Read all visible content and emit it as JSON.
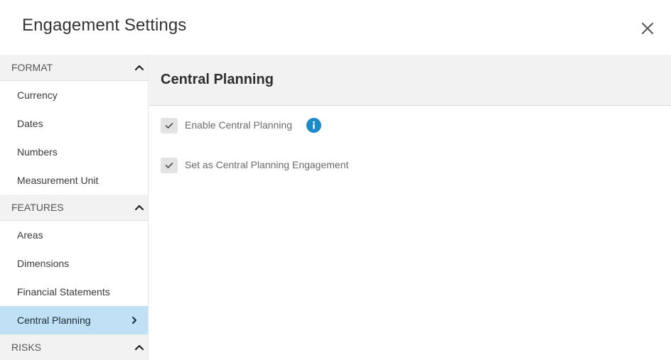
{
  "dialog": {
    "title": "Engagement Settings",
    "close_icon": "close-icon"
  },
  "sidebar": {
    "sections": [
      {
        "label": "FORMAT",
        "chevron_icon": "chevron-up-icon",
        "items": [
          {
            "label": "Currency"
          },
          {
            "label": "Dates"
          },
          {
            "label": "Numbers"
          },
          {
            "label": "Measurement Unit"
          }
        ]
      },
      {
        "label": "FEATURES",
        "chevron_icon": "chevron-up-icon",
        "items": [
          {
            "label": "Areas"
          },
          {
            "label": "Dimensions"
          },
          {
            "label": "Financial Statements"
          },
          {
            "label": "Central Planning",
            "active": true,
            "arrow_icon": "chevron-right-icon"
          }
        ]
      },
      {
        "label": "RISKS",
        "chevron_icon": "chevron-up-icon",
        "items": []
      }
    ]
  },
  "main": {
    "title": "Central Planning",
    "options": [
      {
        "label": "Enable Central Planning",
        "checked": true,
        "info_icon": "info-icon"
      },
      {
        "label": "Set as Central Planning Engagement",
        "checked": true
      }
    ]
  },
  "colors": {
    "active_item_bg": "#bfe0f5",
    "section_bg": "#f2f2f2",
    "info_blue": "#1a8acb",
    "checkbox_bg": "#e3e3e3"
  }
}
